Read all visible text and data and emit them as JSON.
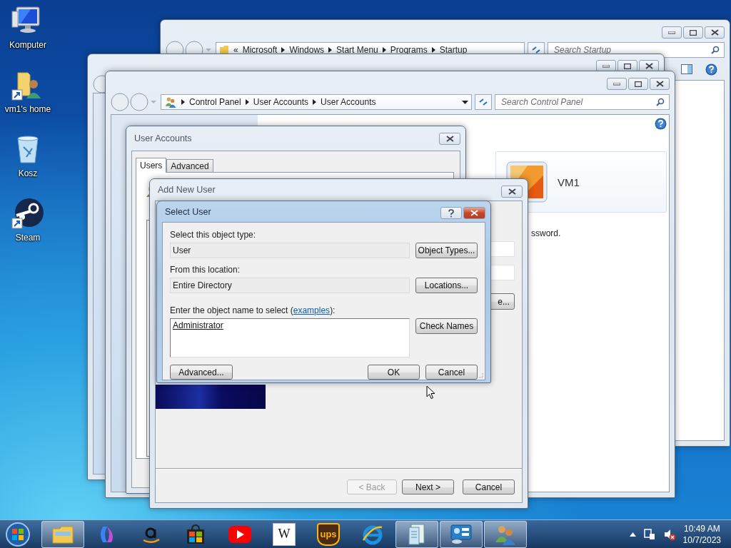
{
  "desktop_icons": [
    {
      "label": "Komputer",
      "kind": "computer",
      "shortcut": false
    },
    {
      "label": "vm1's home",
      "kind": "home",
      "shortcut": true
    },
    {
      "label": "Kosz",
      "kind": "bin",
      "shortcut": false
    },
    {
      "label": "Steam",
      "kind": "steam",
      "shortcut": true
    }
  ],
  "explorer_window": {
    "overflow": "«",
    "breadcrumb": [
      "Microsoft",
      "Windows",
      "Start Menu",
      "Programs",
      "Startup"
    ],
    "search": {
      "placeholder": "Search Startup"
    }
  },
  "control_panel_window": {
    "breadcrumb": [
      "Control Panel",
      "User Accounts",
      "User Accounts"
    ],
    "search": {
      "placeholder": "Search Control Panel"
    },
    "account_name": "VM1",
    "text_fragment": "ssword."
  },
  "user_accounts_dialog": {
    "title": "User Accounts",
    "tabs": [
      {
        "label": "Users",
        "selected": true
      },
      {
        "label": "Advanced",
        "selected": false
      }
    ]
  },
  "add_user_dialog": {
    "title": "Add New User",
    "button_fragment": "e...",
    "buttons": [
      {
        "label": "< Back",
        "disabled": true
      },
      {
        "label": "Next >",
        "disabled": false
      },
      {
        "label": "Cancel",
        "disabled": false
      }
    ]
  },
  "select_user_dialog": {
    "title": "Select User",
    "object_type_label": "Select this object type:",
    "object_type": "User",
    "location_label": "From this location:",
    "location": "Entire Directory",
    "names_label_before": "Enter the object name to select (",
    "names_link": "examples",
    "names_label_after": "):",
    "names_value": "Administrator",
    "side_buttons": [
      "Object Types...",
      "Locations...",
      "Check Names"
    ],
    "advanced_button": "Advanced...",
    "ok_button": "OK",
    "cancel_button": "Cancel"
  },
  "taskbar": {
    "items": [
      {
        "kind": "explorer",
        "open": true
      },
      {
        "kind": "copilot",
        "open": false
      },
      {
        "kind": "amazon",
        "open": false
      },
      {
        "kind": "store",
        "open": false
      },
      {
        "kind": "youtube",
        "open": false
      },
      {
        "kind": "wikipedia",
        "open": false,
        "label": "W"
      },
      {
        "kind": "ups",
        "open": false,
        "label": "ups"
      },
      {
        "kind": "ie",
        "open": false
      },
      {
        "kind": "document",
        "open": true
      },
      {
        "kind": "control-panel",
        "open": true
      },
      {
        "kind": "users",
        "open": true
      }
    ],
    "time": "10:49 AM",
    "date": "10/7/2023"
  }
}
